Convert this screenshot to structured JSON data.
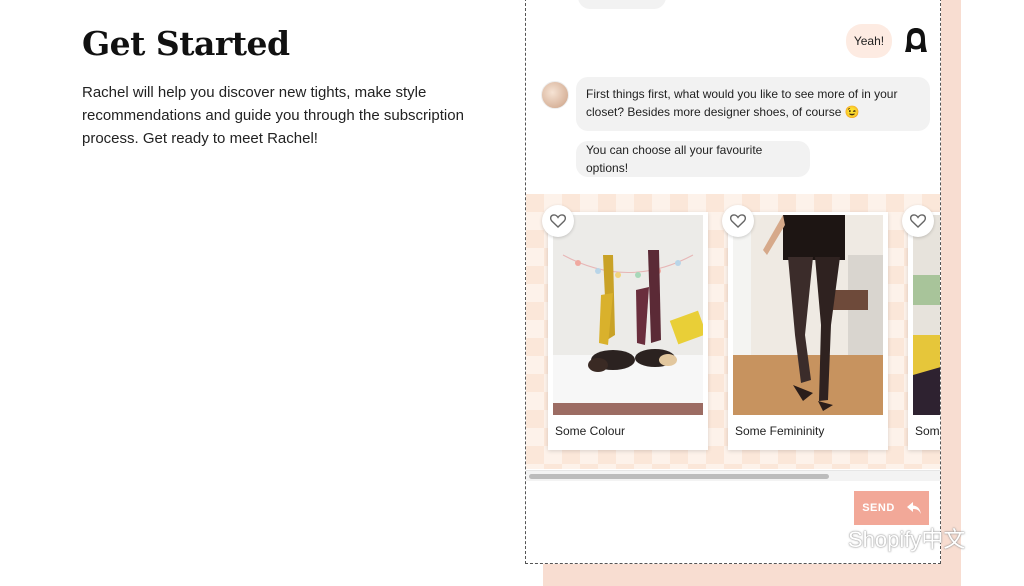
{
  "intro": {
    "title": "Get Started",
    "body": "Rachel will help you discover new tights, make style recommendations and guide you through the subscription process. Get ready to meet Rachel!"
  },
  "chat": {
    "user_reply": "Yeah!",
    "bot_question": "First things first, what would you like to see more of in your closet? Besides more designer shoes, of course 😉",
    "bot_hint": "You can choose all your favourite options!"
  },
  "options": [
    {
      "label": "Some Colour"
    },
    {
      "label": "Some Femininity"
    },
    {
      "label": "Some Pattern"
    }
  ],
  "send": {
    "label": "SEND"
  },
  "watermark": {
    "text": "Shopify中文"
  },
  "colors": {
    "accent": "#f2a898",
    "panel_bg": "#f8ddd1",
    "user_bubble": "#fdebe2"
  }
}
